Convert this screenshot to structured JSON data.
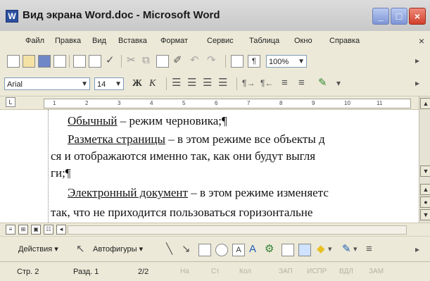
{
  "window": {
    "title": "Вид экрана Word.doc - Microsoft Word",
    "buttons": {
      "minimize": "_",
      "maximize": "□",
      "close": "×"
    }
  },
  "menu": {
    "items": [
      "Файл",
      "Правка",
      "Вид",
      "Вставка",
      "Формат",
      "Сервис",
      "Таблица",
      "Окно",
      "Справка"
    ],
    "close": "×"
  },
  "toolbar": {
    "zoom": "100%",
    "font_name": "Arial",
    "font_size": "14",
    "bold": "Ж",
    "italic": "К",
    "paragraph_mark": "¶"
  },
  "ruler": {
    "ticks": [
      "1",
      "2",
      "3",
      "4",
      "5",
      "6",
      "7",
      "8",
      "9",
      "10",
      "11"
    ]
  },
  "document": {
    "lines": [
      {
        "term": "Обычный",
        "rest": " – режим черновика;¶"
      },
      {
        "term": "Разметка страницы",
        "rest": " – в этом режиме все объекты д"
      },
      {
        "term": "",
        "rest": "ся и отображаются именно так, как они будут выгля"
      },
      {
        "term": "",
        "rest": "ги;¶"
      },
      {
        "term": "Электронный документ",
        "rest": " – в этом режиме изменяетс"
      },
      {
        "term": "",
        "rest": "так, что не приходится пользоваться горизонтальне"
      }
    ]
  },
  "hscroll": {
    "left_arrow": "◄"
  },
  "drawing": {
    "actions_label": "Действия",
    "autoshapes_label": "Автофигуры"
  },
  "status": {
    "page": "Стр. 2",
    "section": "Разд. 1",
    "pages": "2/2",
    "dim": [
      "На",
      "Ст",
      "Кол",
      "ЗАП",
      "ИСПР",
      "ВДЛ",
      "ЗАМ"
    ]
  },
  "colors": {
    "window_bg": "#ece9d8",
    "title_icon": "#2a4f9f",
    "close_button": "#d0402c"
  }
}
